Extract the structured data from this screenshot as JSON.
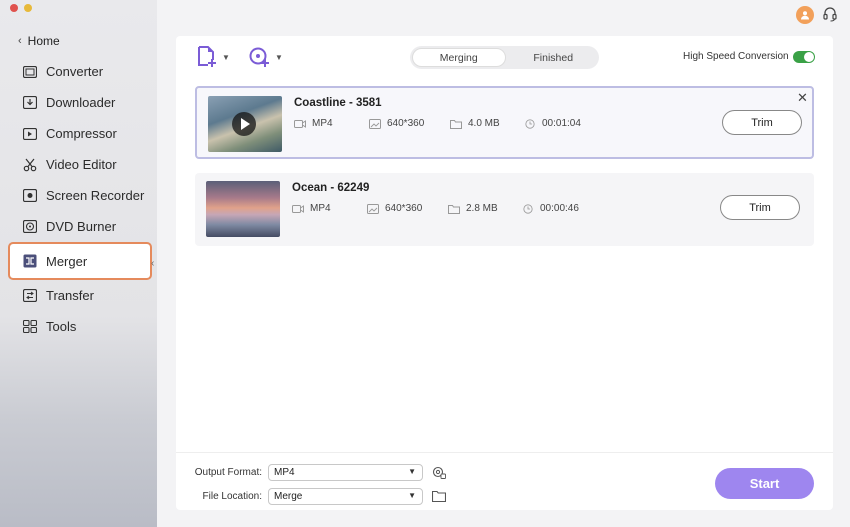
{
  "sidebar": {
    "home_label": "Home",
    "items": [
      {
        "label": "Converter",
        "icon": "converter-icon"
      },
      {
        "label": "Downloader",
        "icon": "downloader-icon"
      },
      {
        "label": "Compressor",
        "icon": "compressor-icon"
      },
      {
        "label": "Video Editor",
        "icon": "video-editor-icon"
      },
      {
        "label": "Screen Recorder",
        "icon": "screen-recorder-icon"
      },
      {
        "label": "DVD Burner",
        "icon": "dvd-icon"
      },
      {
        "label": "Merger",
        "icon": "merger-icon",
        "active": true
      },
      {
        "label": "Transfer",
        "icon": "transfer-icon"
      },
      {
        "label": "Tools",
        "icon": "tools-icon"
      }
    ]
  },
  "toolbar": {
    "tabs": [
      {
        "label": "Merging",
        "active": true
      },
      {
        "label": "Finished",
        "active": false
      }
    ],
    "high_speed_label": "High Speed Conversion",
    "high_speed_on": true
  },
  "files": [
    {
      "title": "Coastline - 3581",
      "format": "MP4",
      "resolution": "640*360",
      "size": "4.0 MB",
      "duration": "00:01:04",
      "trim_label": "Trim",
      "selected": true
    },
    {
      "title": "Ocean - 62249",
      "format": "MP4",
      "resolution": "640*360",
      "size": "2.8 MB",
      "duration": "00:00:46",
      "trim_label": "Trim",
      "selected": false
    }
  ],
  "footer": {
    "output_format_label": "Output Format:",
    "output_format_value": "MP4",
    "file_location_label": "File Location:",
    "file_location_value": "Merge",
    "start_label": "Start"
  },
  "colors": {
    "accent": "#9e86ef",
    "toggle_on": "#3aa146",
    "active_outline": "#e58a5c",
    "icon_purple": "#7b5cd6"
  }
}
